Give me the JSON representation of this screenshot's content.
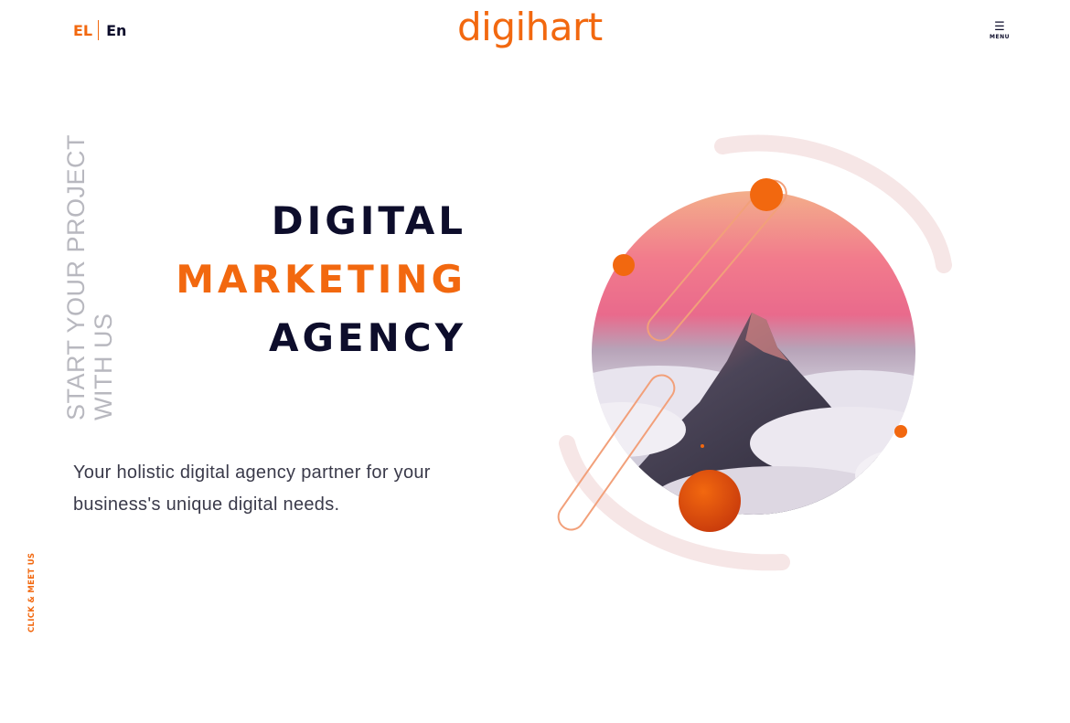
{
  "header": {
    "lang_el": "EL",
    "lang_en": "En",
    "logo_text": "digihart",
    "menu_icon": "hamburger-icon",
    "menu_label": "MENU"
  },
  "side": {
    "project_line1": "START YOUR PROJECT",
    "project_line2": "WITH US",
    "click_meet": "CLICK & MEET US"
  },
  "hero": {
    "line1": "DIGITAL",
    "line2": "MARKETING",
    "line3": "AGENCY",
    "tagline_line1": "Your holistic digital agency partner for your",
    "tagline_line2": "business's unique digital needs.",
    "image_subject": "mountain peak above clouds at sunset"
  },
  "colors": {
    "accent": "#f2680f",
    "dark": "#0d0d2b",
    "muted": "#b8b8bf"
  }
}
